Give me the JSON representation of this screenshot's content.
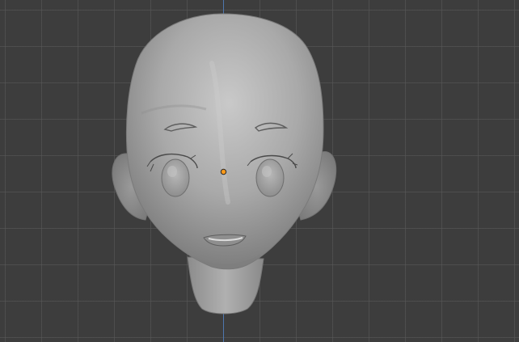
{
  "viewport": {
    "background_color": "#3d3d3d",
    "grid_color": "#5a5a5a",
    "z_axis_color": "#4f7fbf",
    "mesh_color": "#a8a8a8",
    "origin_color": "#ff9a1a"
  },
  "scene": {
    "object": "head-mesh",
    "shading": "solid"
  },
  "icons": {
    "origin": "origin-dot-icon"
  }
}
